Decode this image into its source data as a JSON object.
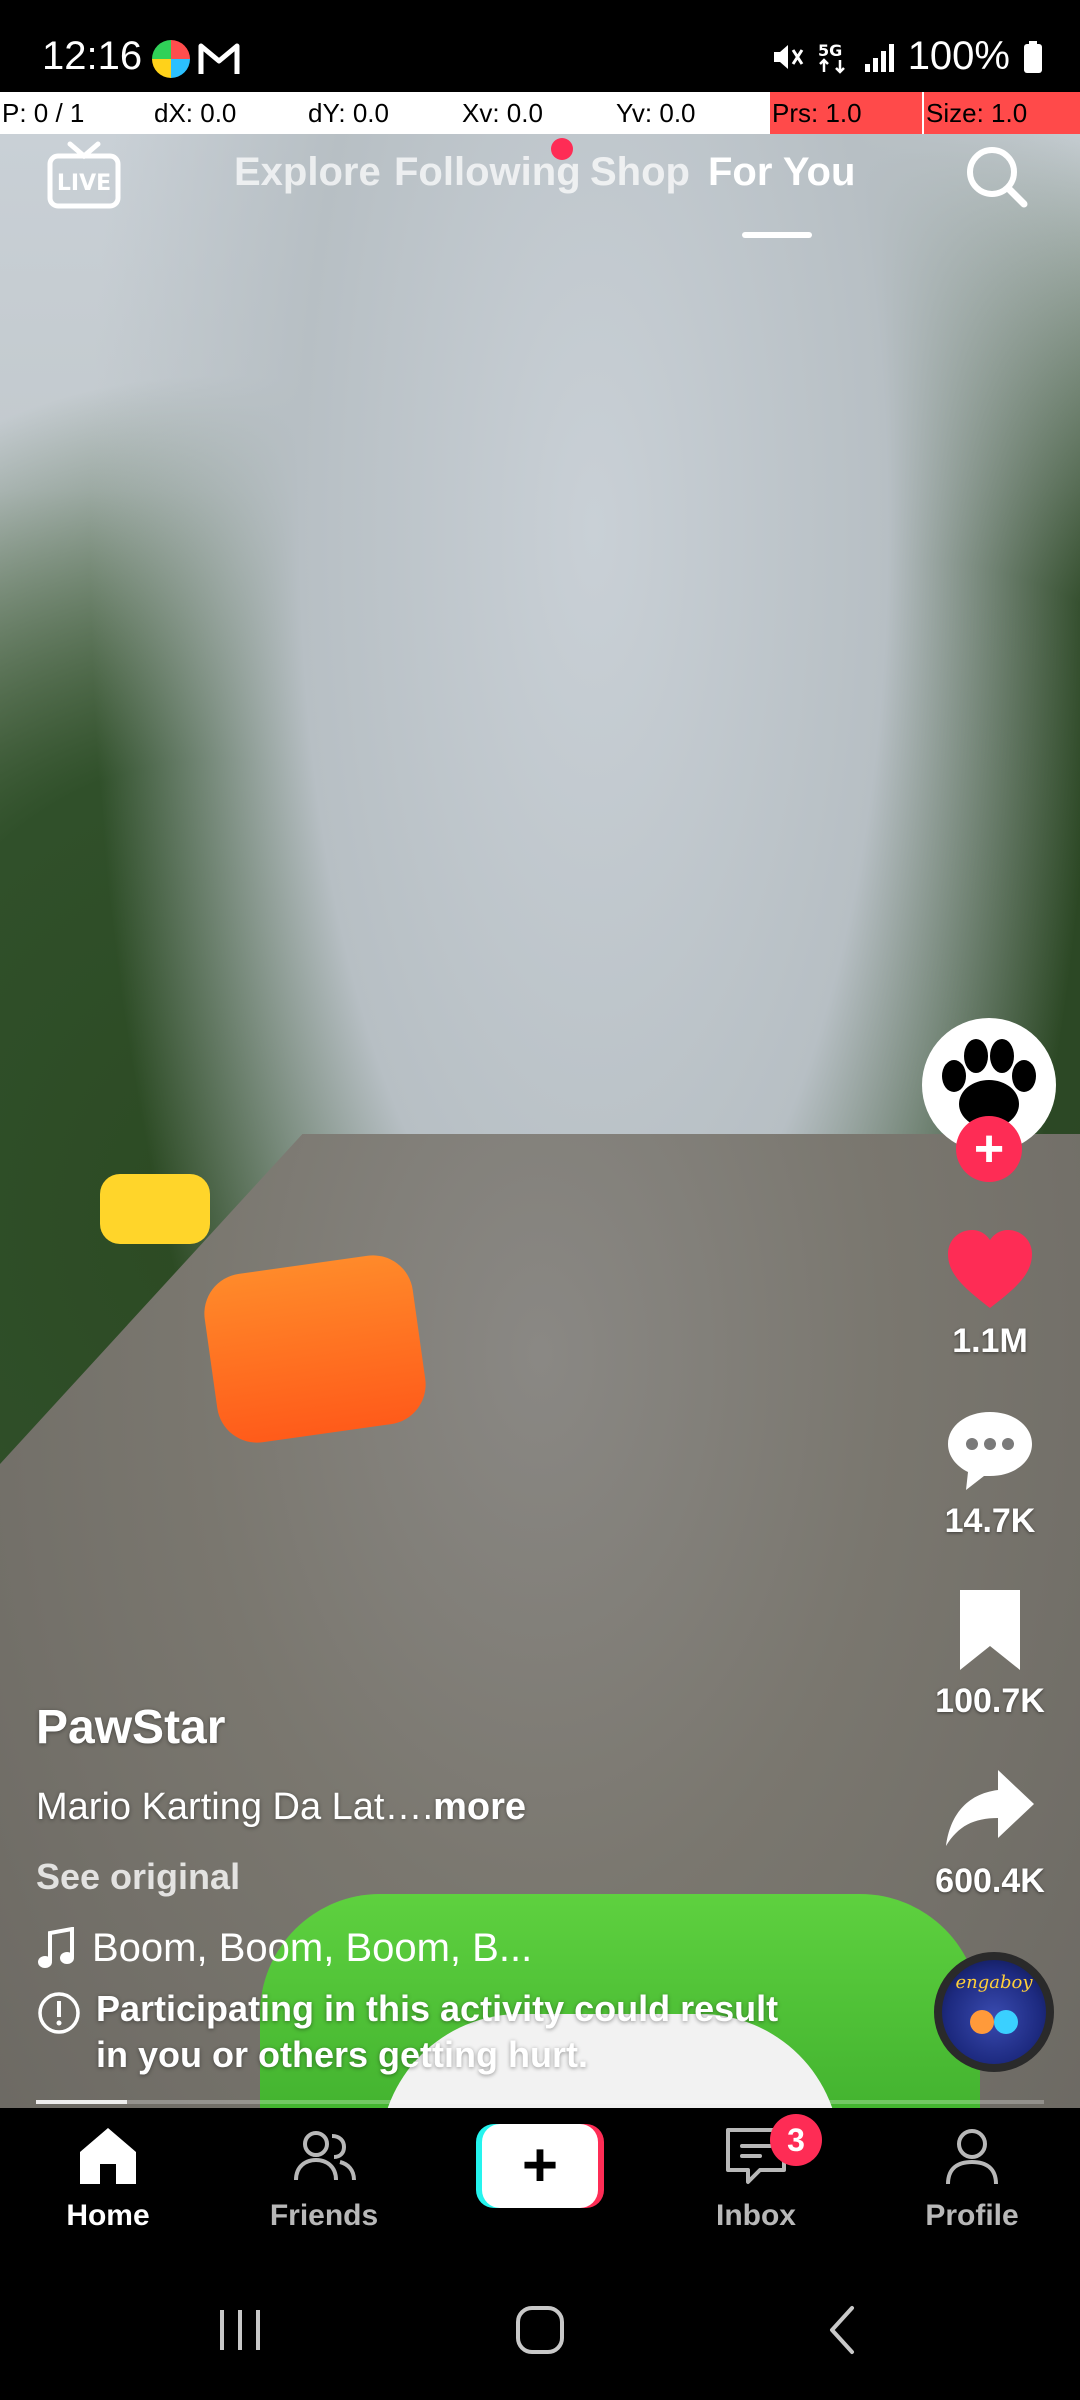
{
  "status_bar": {
    "time": "12:16",
    "battery": "100%",
    "icons": [
      "ring-app-icon",
      "gmail-icon",
      "mute-icon",
      "5g-icon",
      "signal-icon",
      "battery-icon"
    ]
  },
  "pointer_overlay": {
    "p": "P: 0 / 1",
    "dx": "dX: 0.0",
    "dy": "dY: 0.0",
    "xv": "Xv: 0.0",
    "yv": "Yv: 0.0",
    "prs": "Prs: 1.0",
    "size": "Size: 1.0"
  },
  "top_nav": {
    "live_label": "LIVE",
    "tabs": [
      {
        "label": "Explore",
        "active": false
      },
      {
        "label": "Following",
        "active": false
      },
      {
        "label": "Shop",
        "active": false
      },
      {
        "label": "For You",
        "active": true
      }
    ]
  },
  "actions": {
    "likes": "1.1M",
    "comments": "14.7K",
    "saves": "100.7K",
    "shares": "600.4K"
  },
  "post": {
    "author": "PawStar",
    "caption": "Mario Karting Da Lat….",
    "caption_more": "more",
    "see_original": "See original",
    "music": "Boom, Boom, Boom, B...",
    "warning": "Participating in this activity could result in you or others getting hurt.",
    "disc_label": "engaboy"
  },
  "progress": 0.09,
  "bottom_nav": {
    "items": [
      {
        "label": "Home",
        "active": true
      },
      {
        "label": "Friends",
        "active": false
      },
      {
        "label": "Inbox",
        "active": false
      },
      {
        "label": "Profile",
        "active": false
      }
    ],
    "inbox_badge": "3"
  },
  "colors": {
    "accent": "#fe2c55",
    "cyan": "#25f4ee",
    "overlay_red": "#ff4a4a"
  }
}
